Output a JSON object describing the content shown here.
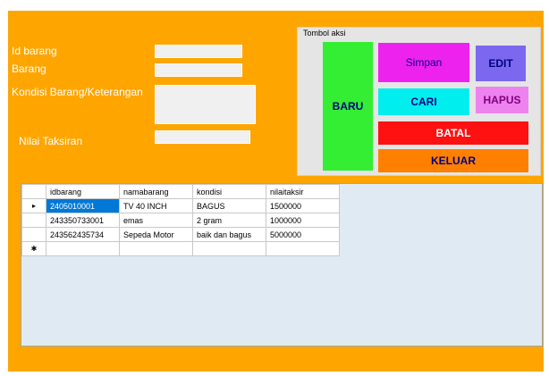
{
  "labels": {
    "id_barang": "Id barang",
    "barang": "Barang",
    "kondisi": "Kondisi Barang/Keterangan",
    "nilai": "Nilai Taksiran"
  },
  "inputs": {
    "id_barang": "",
    "barang": "",
    "kondisi": "",
    "nilai": ""
  },
  "group": {
    "title": "Tombol aksi",
    "buttons": {
      "baru": "BARU",
      "simpan": "Simpan",
      "edit": "EDIT",
      "cari": "CARI",
      "hapus": "HAPUS",
      "batal": "BATAL",
      "keluar": "KELUAR"
    }
  },
  "colors": {
    "form_bg": "#ffa500",
    "baru": "#33ee33",
    "simpan": "#ee22ee",
    "edit": "#7b68ee",
    "cari": "#00eeee",
    "hapus": "#ee82ee",
    "batal": "#ff1111",
    "keluar": "#ff8000"
  },
  "grid": {
    "columns": [
      "idbarang",
      "namabarang",
      "kondisi",
      "nilaitaksir"
    ],
    "rows": [
      {
        "marker": "▸",
        "cells": [
          "2405010001",
          "TV 40 INCH",
          "BAGUS",
          "1500000"
        ]
      },
      {
        "marker": "",
        "cells": [
          "243350733001",
          "emas",
          "2 gram",
          "1000000"
        ]
      },
      {
        "marker": "",
        "cells": [
          "243562435734",
          "Sepeda Motor",
          "baik dan bagus",
          "5000000"
        ]
      },
      {
        "marker": "✱",
        "cells": [
          "",
          "",
          "",
          ""
        ]
      }
    ]
  }
}
